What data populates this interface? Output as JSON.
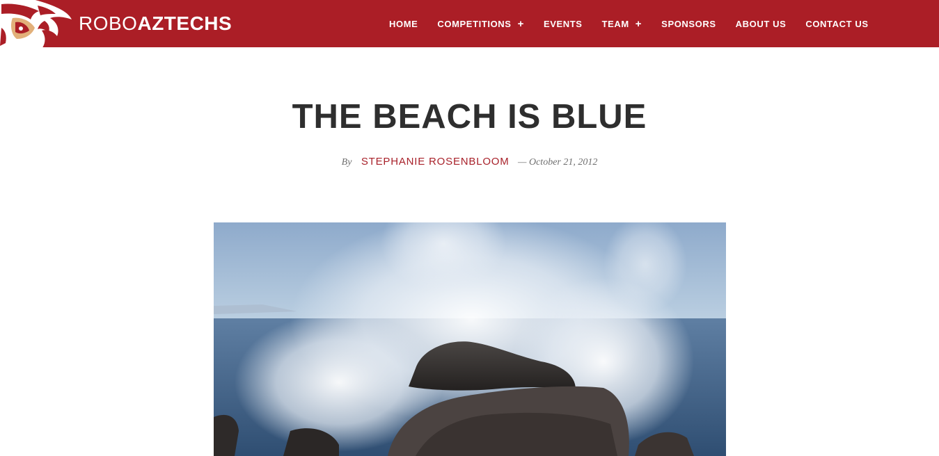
{
  "colors": {
    "brand": "#ab1e26",
    "title": "#2e2e2e",
    "author": "#a8212a",
    "meta": "#6f6f6f"
  },
  "logo": {
    "text_light": "ROBO",
    "text_bold": "AZTECHS",
    "icon": "aztec-eagle-icon"
  },
  "nav": {
    "items": [
      {
        "label": "HOME",
        "has_submenu": false
      },
      {
        "label": "COMPETITIONS",
        "has_submenu": true
      },
      {
        "label": "EVENTS",
        "has_submenu": false
      },
      {
        "label": "TEAM",
        "has_submenu": true
      },
      {
        "label": "SPONSORS",
        "has_submenu": false
      },
      {
        "label": "ABOUT US",
        "has_submenu": false
      },
      {
        "label": "CONTACT US",
        "has_submenu": false
      }
    ],
    "submenu_icon": "+"
  },
  "post": {
    "title": "THE BEACH IS BLUE",
    "by": "By",
    "author": "STEPHANIE ROSENBLOOM",
    "date": "— October 21, 2012",
    "image": "wave-crashing-on-rocks-photo"
  }
}
